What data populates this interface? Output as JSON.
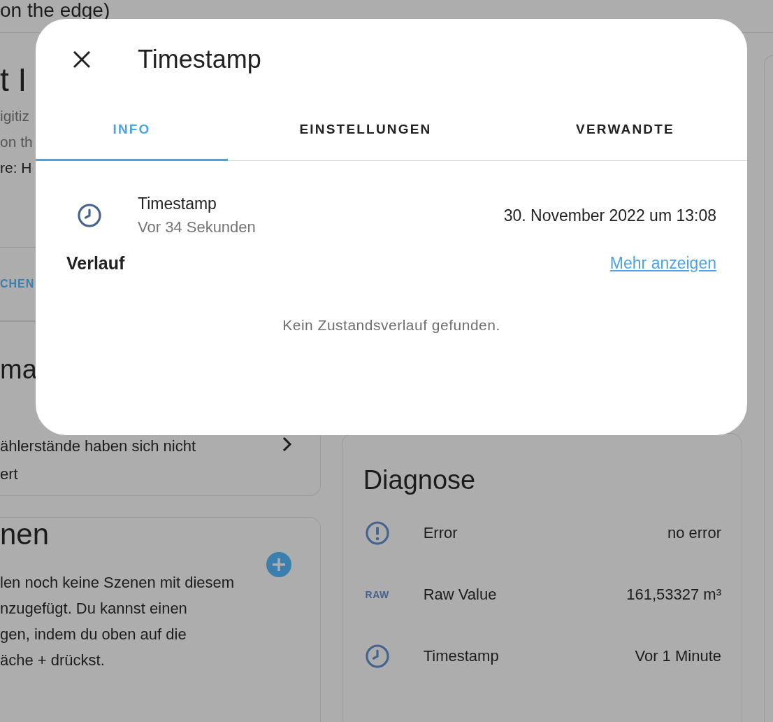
{
  "page_title": "on the edge)",
  "info_card": {
    "title": "t I",
    "lines": [
      "igitiz",
      "on th"
    ],
    "detail": "re: H",
    "action": "CHEN"
  },
  "automation_card": {
    "title": "ma",
    "lines": [
      "ählerstände haben sich nicht",
      "ert"
    ]
  },
  "scenes_card": {
    "title": "nen",
    "lines": [
      "len noch keine Szenen mit diesem",
      "nzugefügt. Du kannst einen",
      "gen, indem du oben auf die",
      "äche + drückst."
    ]
  },
  "diagnose_card": {
    "title": "Diagnose",
    "rows": [
      {
        "kind": "alert",
        "name": "Error",
        "value": "no error"
      },
      {
        "kind": "raw",
        "icon_text": "RAW",
        "name": "Raw Value",
        "value": "161,53327 m³"
      },
      {
        "kind": "clock",
        "name": "Timestamp",
        "value": "Vor 1 Minute"
      }
    ]
  },
  "dialog": {
    "title": "Timestamp",
    "tabs": [
      {
        "label": "INFO",
        "selected": true
      },
      {
        "label": "EINSTELLUNGEN",
        "selected": false
      },
      {
        "label": "VERWANDTE",
        "selected": false
      }
    ],
    "entity": {
      "name": "Timestamp",
      "secondary": "Vor 34 Sekunden",
      "value": "30. November 2022 um 13:08"
    },
    "history": {
      "title": "Verlauf",
      "link": "Mehr anzeigen",
      "empty": "Kein Zustandsverlauf gefunden."
    }
  }
}
